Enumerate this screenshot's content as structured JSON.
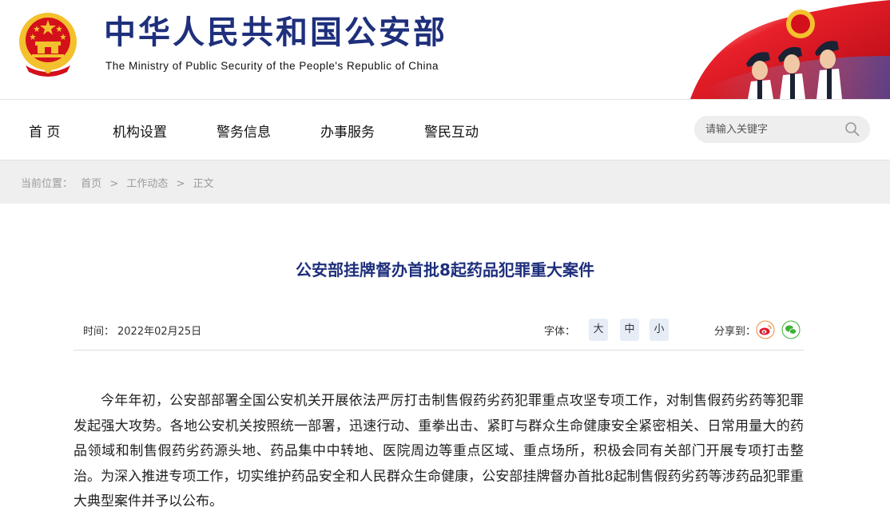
{
  "header": {
    "title": "中华人民共和国公安部",
    "subtitle": "The Ministry of Public Security of the People's Republic of China",
    "emblem_icon": "national-emblem-icon",
    "banner_image": "police-officers-flag-banner"
  },
  "nav": {
    "items": [
      "首 页",
      "机构设置",
      "警务信息",
      "办事服务",
      "警民互动"
    ],
    "search": {
      "placeholder": "请输入关键字",
      "value": "",
      "icon": "search-icon"
    }
  },
  "breadcrumb": {
    "label": "当前位置：",
    "items": [
      "首页",
      "工作动态",
      "正文"
    ],
    "sep": ">"
  },
  "article": {
    "title": "公安部挂牌督办首批8起药品犯罪重大案件",
    "time_label": "时间：",
    "time_value": "2022年02月25日",
    "font_label": "字体：",
    "font_sizes": [
      "大",
      "中",
      "小"
    ],
    "share_label": "分享到：",
    "share_icons": [
      "weibo-icon",
      "wechat-icon"
    ],
    "body": "今年年初，公安部部署全国公安机关开展依法严厉打击制售假药劣药犯罪重点攻坚专项工作，对制售假药劣药等犯罪发起强大攻势。各地公安机关按照统一部署，迅速行动、重拳出击、紧盯与群众生命健康安全紧密相关、日常用量大的药品领域和制售假药劣药源头地、药品集中中转地、医院周边等重点区域、重点场所，积极会同有关部门开展专项打击整治。为深入推进专项工作，切实维护药品安全和人民群众生命健康，公安部挂牌督办首批8起制售假药劣药等涉药品犯罪重大典型案件并予以公布。"
  },
  "colors": {
    "title_blue": "#1e2f7c",
    "emblem_red": "#d4101b",
    "emblem_gold": "#f3c12d",
    "weibo": "#e6162d",
    "wechat": "#3eb135"
  }
}
